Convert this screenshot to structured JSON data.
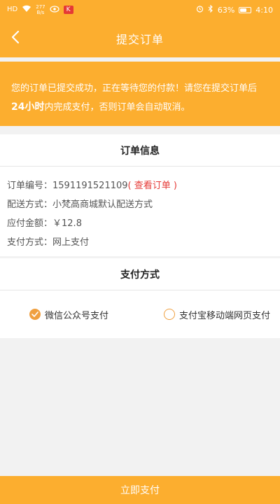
{
  "status_bar": {
    "signal": "HD",
    "net_speed_value": "277",
    "net_speed_unit": "B/s",
    "badge": "K",
    "battery": "63%",
    "battery_level": 0.63,
    "time": "4:10"
  },
  "nav": {
    "title": "提交订单"
  },
  "notice": {
    "line1": "您的订单已提交成功，正在等待您的付款！请您在提交订单后",
    "bold": "24小时",
    "line2": "内完成支付，否则订单会自动取消。"
  },
  "order_info": {
    "header": "订单信息",
    "order_no_label": "订单编号：",
    "order_no_value": "1591191521109",
    "view_order_link": "( 查看订单 )",
    "delivery_label": "配送方式：",
    "delivery_value": "小梵高商城默认配送方式",
    "amount_label": "应付金额：",
    "amount_value": "￥12.8",
    "payment_label": "支付方式：",
    "payment_value": "网上支付"
  },
  "payment": {
    "header": "支付方式",
    "options": [
      {
        "label": "微信公众号支付",
        "selected": true
      },
      {
        "label": "支付宝移动端网页支付",
        "selected": false
      }
    ]
  },
  "submit": {
    "label": "立即支付"
  },
  "colors": {
    "primary": "#fcae2f",
    "link_red": "#e53935",
    "radio": "#f0a040"
  }
}
